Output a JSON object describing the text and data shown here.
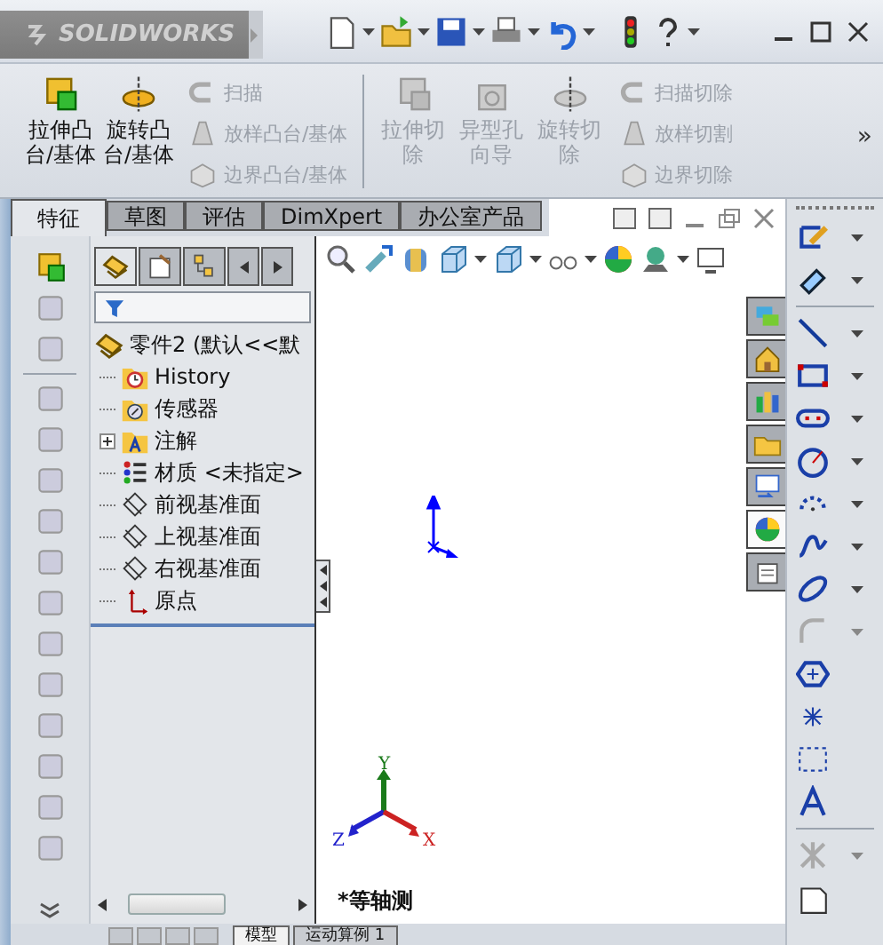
{
  "logo": {
    "text": "SOLIDWORKS"
  },
  "ribbon": {
    "large": [
      {
        "label": "拉伸凸台/基体",
        "kind": "extrude",
        "disabled": false
      },
      {
        "label": "旋转凸台/基体",
        "kind": "revolve",
        "disabled": false
      }
    ],
    "small_left": [
      {
        "label": "扫描",
        "kind": "sweep",
        "disabled": true
      },
      {
        "label": "放样凸台/基体",
        "kind": "loft",
        "disabled": true
      },
      {
        "label": "边界凸台/基体",
        "kind": "boundary",
        "disabled": true
      }
    ],
    "cut_large": [
      {
        "label": "拉伸切除",
        "kind": "extrude",
        "disabled": true
      },
      {
        "label": "异型孔向导",
        "kind": "hole",
        "disabled": true
      },
      {
        "label": "旋转切除",
        "kind": "revolve",
        "disabled": true
      }
    ],
    "small_right": [
      {
        "label": "扫描切除",
        "kind": "sweep",
        "disabled": true
      },
      {
        "label": "放样切割",
        "kind": "loft",
        "disabled": true
      },
      {
        "label": "边界切除",
        "kind": "boundary",
        "disabled": true
      }
    ],
    "more": "»"
  },
  "tabs": [
    {
      "label": "特征",
      "selected": true
    },
    {
      "label": "草图",
      "selected": false
    },
    {
      "label": "评估",
      "selected": false
    },
    {
      "label": "DimXpert",
      "selected": false
    },
    {
      "label": "办公室产品",
      "selected": false
    }
  ],
  "feature_tree": {
    "root": "零件2 (默认<<默",
    "items": [
      {
        "label": "History",
        "kind": "history"
      },
      {
        "label": "传感器",
        "kind": "sensors"
      },
      {
        "label": "注解",
        "kind": "annotations",
        "expanded": false
      },
      {
        "label": "材质 <未指定>",
        "kind": "material"
      },
      {
        "label": "前视基准面",
        "kind": "plane"
      },
      {
        "label": "上视基准面",
        "kind": "plane"
      },
      {
        "label": "右视基准面",
        "kind": "plane"
      },
      {
        "label": "原点",
        "kind": "origin"
      }
    ]
  },
  "view": {
    "name": "*等轴测",
    "triad": {
      "x": "X",
      "y": "Y",
      "z": "Z"
    }
  },
  "task_pane": [
    {
      "kind": "resources",
      "selected": false
    },
    {
      "kind": "home",
      "selected": false
    },
    {
      "kind": "library",
      "selected": false
    },
    {
      "kind": "folder",
      "selected": false
    },
    {
      "kind": "palette",
      "selected": false
    },
    {
      "kind": "appearance",
      "selected": true
    },
    {
      "kind": "properties",
      "selected": false
    }
  ],
  "bottom_tabs": [
    {
      "label": "模型",
      "selected": true
    },
    {
      "label": "运动算例 1",
      "selected": false
    }
  ]
}
